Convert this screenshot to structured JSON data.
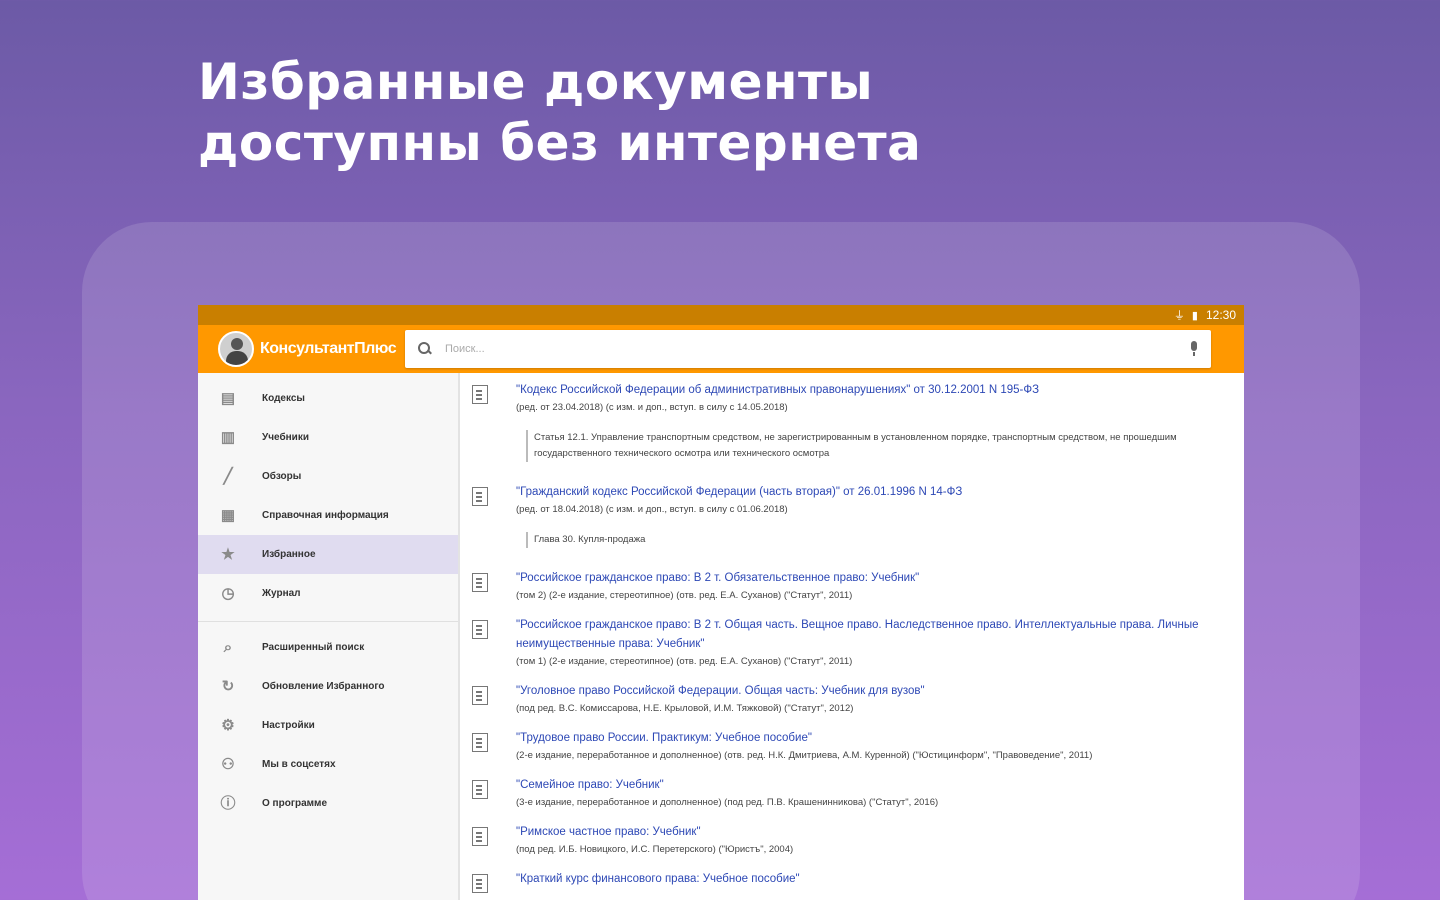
{
  "promo": {
    "line1": "Избранные документы",
    "line2": "доступны без интернета"
  },
  "status_bar": {
    "icons": "⏚ ▮",
    "time": "12:30"
  },
  "app_bar": {
    "logo_text": "КонсультантПлюс",
    "search_placeholder": "Поиск..."
  },
  "sidebar": {
    "items": [
      {
        "label": "Кодексы",
        "icon": "book-icon",
        "glyph": "▤"
      },
      {
        "label": "Учебники",
        "icon": "textbook-icon",
        "glyph": "▥"
      },
      {
        "label": "Обзоры",
        "icon": "pen-icon",
        "glyph": "╱"
      },
      {
        "label": "Справочная информация",
        "icon": "reference-icon",
        "glyph": "▦"
      },
      {
        "label": "Избранное",
        "icon": "star-icon",
        "glyph": "★",
        "active": true
      },
      {
        "label": "Журнал",
        "icon": "history-icon",
        "glyph": "◷"
      }
    ],
    "items2": [
      {
        "label": "Расширенный поиск",
        "icon": "advanced-search-icon",
        "glyph": "⌕"
      },
      {
        "label": "Обновление Избранного",
        "icon": "refresh-icon",
        "glyph": "↻"
      },
      {
        "label": "Настройки",
        "icon": "gear-icon",
        "glyph": "⚙"
      },
      {
        "label": "Мы в соцсетях",
        "icon": "social-icon",
        "glyph": "⚇"
      },
      {
        "label": "О программе",
        "icon": "info-icon",
        "glyph": "ⓘ"
      }
    ]
  },
  "documents": [
    {
      "title": "\"Кодекс Российской Федерации об административных правонарушениях\" от 30.12.2001 N 195-ФЗ",
      "meta": "(ред. от 23.04.2018) (с изм. и доп., вступ. в силу с 14.05.2018)",
      "quote": "Статья 12.1. Управление транспортным средством, не зарегистрированным в установленном порядке, транспортным средством, не прошедшим государственного технического осмотра или технического осмотра"
    },
    {
      "title": "\"Гражданский кодекс Российской Федерации (часть вторая)\" от 26.01.1996 N 14-ФЗ",
      "meta": "(ред. от 18.04.2018) (с изм. и доп., вступ. в силу с 01.06.2018)",
      "quote": "Глава 30. Купля-продажа"
    },
    {
      "title": "\"Российское гражданское право: В 2 т. Обязательственное право: Учебник\"",
      "meta": "(том 2) (2-е издание, стереотипное) (отв. ред. Е.А. Суханов) (\"Статут\", 2011)"
    },
    {
      "title": "\"Российское гражданское право: В 2 т. Общая часть. Вещное право. Наследственное право. Интеллектуальные права. Личные неимущественные права: Учебник\"",
      "meta": "(том 1) (2-е издание, стереотипное) (отв. ред. Е.А. Суханов) (\"Статут\", 2011)"
    },
    {
      "title": "\"Уголовное право Российской Федерации. Общая часть: Учебник для вузов\"",
      "meta": "(под ред. В.С. Комиссарова, Н.Е. Крыловой, И.М. Тяжковой) (\"Статут\", 2012)"
    },
    {
      "title": "\"Трудовое право России. Практикум: Учебное пособие\"",
      "meta": "(2-е издание, переработанное и дополненное) (отв. ред. Н.К. Дмитриева, А.М. Куренной) (\"Юстицинформ\", \"Правоведение\", 2011)"
    },
    {
      "title": "\"Семейное право: Учебник\"",
      "meta": "(3-е издание, переработанное и дополненное) (под ред. П.В. Крашенинникова) (\"Статут\", 2016)"
    },
    {
      "title": "\"Римское частное право: Учебник\"",
      "meta": "(под ред. И.Б. Новицкого, И.С. Перетерского) (\"Юристъ\", 2004)"
    },
    {
      "title": "\"Краткий курс финансового права: Учебное пособие\"",
      "meta": ""
    }
  ]
}
